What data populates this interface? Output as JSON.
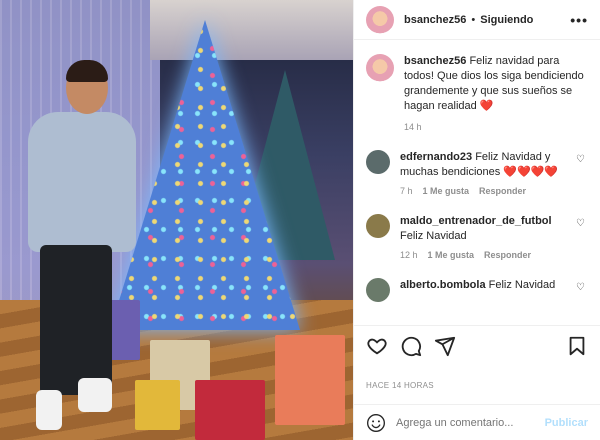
{
  "post": {
    "username": "bsanchez56",
    "follow_status": "Siguiendo",
    "more": "•••"
  },
  "caption": {
    "username": "bsanchez56",
    "text": "Feliz navidad para todos! Que dios los siga bendiciendo grandemente y que sus sueños se hagan realidad",
    "emoji": "❤️",
    "time": "14 h"
  },
  "comments": [
    {
      "username": "edfernando23",
      "text": "Feliz Navidad y muchas bendiciones ❤️❤️❤️❤️",
      "time": "7 h",
      "likes": "1 Me gusta",
      "reply": "Responder",
      "avatar_color": "#5b6b6b"
    },
    {
      "username": "maldo_entrenador_de_futbol",
      "text": "Feliz Navidad",
      "time": "12 h",
      "likes": "1 Me gusta",
      "reply": "Responder",
      "avatar_color": "#8a7a4a"
    },
    {
      "username": "alberto.bombola",
      "text": "Feliz Navidad",
      "avatar_color": "#6a7a6a"
    }
  ],
  "actions": {
    "icons": [
      "heart-icon",
      "comment-icon",
      "share-icon",
      "save-icon"
    ]
  },
  "timestamp": "HACE 14 HORAS",
  "composer": {
    "placeholder": "Agrega un comentario...",
    "post_label": "Publicar"
  },
  "colors": {
    "link": "#0095f6",
    "post_disabled": "#b2dffc",
    "muted": "#8e8e8e",
    "heart": "#ed4956"
  }
}
